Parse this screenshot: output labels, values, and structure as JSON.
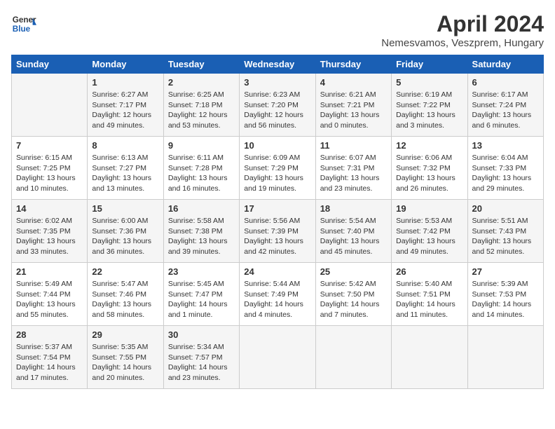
{
  "logo": {
    "general": "General",
    "blue": "Blue"
  },
  "title": "April 2024",
  "location": "Nemesvamos, Veszprem, Hungary",
  "days_header": [
    "Sunday",
    "Monday",
    "Tuesday",
    "Wednesday",
    "Thursday",
    "Friday",
    "Saturday"
  ],
  "weeks": [
    [
      {
        "day": "",
        "content": ""
      },
      {
        "day": "1",
        "content": "Sunrise: 6:27 AM\nSunset: 7:17 PM\nDaylight: 12 hours\nand 49 minutes."
      },
      {
        "day": "2",
        "content": "Sunrise: 6:25 AM\nSunset: 7:18 PM\nDaylight: 12 hours\nand 53 minutes."
      },
      {
        "day": "3",
        "content": "Sunrise: 6:23 AM\nSunset: 7:20 PM\nDaylight: 12 hours\nand 56 minutes."
      },
      {
        "day": "4",
        "content": "Sunrise: 6:21 AM\nSunset: 7:21 PM\nDaylight: 13 hours\nand 0 minutes."
      },
      {
        "day": "5",
        "content": "Sunrise: 6:19 AM\nSunset: 7:22 PM\nDaylight: 13 hours\nand 3 minutes."
      },
      {
        "day": "6",
        "content": "Sunrise: 6:17 AM\nSunset: 7:24 PM\nDaylight: 13 hours\nand 6 minutes."
      }
    ],
    [
      {
        "day": "7",
        "content": "Sunrise: 6:15 AM\nSunset: 7:25 PM\nDaylight: 13 hours\nand 10 minutes."
      },
      {
        "day": "8",
        "content": "Sunrise: 6:13 AM\nSunset: 7:27 PM\nDaylight: 13 hours\nand 13 minutes."
      },
      {
        "day": "9",
        "content": "Sunrise: 6:11 AM\nSunset: 7:28 PM\nDaylight: 13 hours\nand 16 minutes."
      },
      {
        "day": "10",
        "content": "Sunrise: 6:09 AM\nSunset: 7:29 PM\nDaylight: 13 hours\nand 19 minutes."
      },
      {
        "day": "11",
        "content": "Sunrise: 6:07 AM\nSunset: 7:31 PM\nDaylight: 13 hours\nand 23 minutes."
      },
      {
        "day": "12",
        "content": "Sunrise: 6:06 AM\nSunset: 7:32 PM\nDaylight: 13 hours\nand 26 minutes."
      },
      {
        "day": "13",
        "content": "Sunrise: 6:04 AM\nSunset: 7:33 PM\nDaylight: 13 hours\nand 29 minutes."
      }
    ],
    [
      {
        "day": "14",
        "content": "Sunrise: 6:02 AM\nSunset: 7:35 PM\nDaylight: 13 hours\nand 33 minutes."
      },
      {
        "day": "15",
        "content": "Sunrise: 6:00 AM\nSunset: 7:36 PM\nDaylight: 13 hours\nand 36 minutes."
      },
      {
        "day": "16",
        "content": "Sunrise: 5:58 AM\nSunset: 7:38 PM\nDaylight: 13 hours\nand 39 minutes."
      },
      {
        "day": "17",
        "content": "Sunrise: 5:56 AM\nSunset: 7:39 PM\nDaylight: 13 hours\nand 42 minutes."
      },
      {
        "day": "18",
        "content": "Sunrise: 5:54 AM\nSunset: 7:40 PM\nDaylight: 13 hours\nand 45 minutes."
      },
      {
        "day": "19",
        "content": "Sunrise: 5:53 AM\nSunset: 7:42 PM\nDaylight: 13 hours\nand 49 minutes."
      },
      {
        "day": "20",
        "content": "Sunrise: 5:51 AM\nSunset: 7:43 PM\nDaylight: 13 hours\nand 52 minutes."
      }
    ],
    [
      {
        "day": "21",
        "content": "Sunrise: 5:49 AM\nSunset: 7:44 PM\nDaylight: 13 hours\nand 55 minutes."
      },
      {
        "day": "22",
        "content": "Sunrise: 5:47 AM\nSunset: 7:46 PM\nDaylight: 13 hours\nand 58 minutes."
      },
      {
        "day": "23",
        "content": "Sunrise: 5:45 AM\nSunset: 7:47 PM\nDaylight: 14 hours\nand 1 minute."
      },
      {
        "day": "24",
        "content": "Sunrise: 5:44 AM\nSunset: 7:49 PM\nDaylight: 14 hours\nand 4 minutes."
      },
      {
        "day": "25",
        "content": "Sunrise: 5:42 AM\nSunset: 7:50 PM\nDaylight: 14 hours\nand 7 minutes."
      },
      {
        "day": "26",
        "content": "Sunrise: 5:40 AM\nSunset: 7:51 PM\nDaylight: 14 hours\nand 11 minutes."
      },
      {
        "day": "27",
        "content": "Sunrise: 5:39 AM\nSunset: 7:53 PM\nDaylight: 14 hours\nand 14 minutes."
      }
    ],
    [
      {
        "day": "28",
        "content": "Sunrise: 5:37 AM\nSunset: 7:54 PM\nDaylight: 14 hours\nand 17 minutes."
      },
      {
        "day": "29",
        "content": "Sunrise: 5:35 AM\nSunset: 7:55 PM\nDaylight: 14 hours\nand 20 minutes."
      },
      {
        "day": "30",
        "content": "Sunrise: 5:34 AM\nSunset: 7:57 PM\nDaylight: 14 hours\nand 23 minutes."
      },
      {
        "day": "",
        "content": ""
      },
      {
        "day": "",
        "content": ""
      },
      {
        "day": "",
        "content": ""
      },
      {
        "day": "",
        "content": ""
      }
    ]
  ]
}
